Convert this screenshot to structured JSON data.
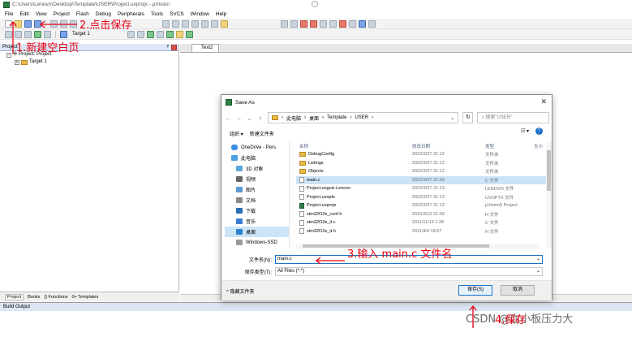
{
  "window": {
    "title": "C:\\Users\\Lenovo\\Desktop\\Template\\USER\\Project.uvprojx - µVision"
  },
  "menu": [
    "File",
    "Edit",
    "View",
    "Project",
    "Flash",
    "Debug",
    "Peripherals",
    "Tools",
    "SVCS",
    "Window",
    "Help"
  ],
  "toolbar": {
    "target": "Target 1"
  },
  "project_panel": {
    "title": "Project",
    "root": "Project: Project",
    "target": "Target 1",
    "tabs": [
      "Project",
      "Books",
      "{} Functions",
      "0+ Templates"
    ]
  },
  "editor": {
    "tab": "Text2"
  },
  "build_output": {
    "title": "Build Output"
  },
  "dialog": {
    "title": "Save As",
    "breadcrumb": [
      "此电脑",
      "桌面",
      "Template",
      "USER"
    ],
    "search_placeholder": "搜索\"USER\"",
    "organize": "组织 ▾",
    "new_folder": "新建文件夹",
    "nav": [
      {
        "label": "OneDrive - Pers",
        "icon": "cloud-icon"
      },
      {
        "label": "此电脑",
        "icon": "computer-icon"
      },
      {
        "label": "3D 对象",
        "icon": "3d-objects-icon"
      },
      {
        "label": "视频",
        "icon": "video-icon"
      },
      {
        "label": "图片",
        "icon": "pictures-icon"
      },
      {
        "label": "文档",
        "icon": "documents-icon"
      },
      {
        "label": "下载",
        "icon": "download-icon"
      },
      {
        "label": "音乐",
        "icon": "music-icon"
      },
      {
        "label": "桌面",
        "icon": "desktop-icon"
      },
      {
        "label": "Windows-SSD",
        "icon": "drive-icon"
      }
    ],
    "columns": {
      "name": "名称",
      "date": "修改日期",
      "type": "类型",
      "size": "大小"
    },
    "files": [
      {
        "name": "DebugConfig",
        "date": "2022/3/27 21:12",
        "type": "文件夹",
        "kind": "folder"
      },
      {
        "name": "Listings",
        "date": "2022/3/27 21:12",
        "type": "文件夹",
        "kind": "folder"
      },
      {
        "name": "Objects",
        "date": "2022/3/27 21:12",
        "type": "文件夹",
        "kind": "folder"
      },
      {
        "name": "main.c",
        "date": "2022/3/27 21:59",
        "type": "C 文件",
        "kind": "file"
      },
      {
        "name": "Project.uvguix.Lenovo",
        "date": "2022/3/27 21:13",
        "type": "LENOVO 文件",
        "kind": "file"
      },
      {
        "name": "Project.uvoptx",
        "date": "2022/3/27 21:13",
        "type": "UVOPTX 文件",
        "kind": "file"
      },
      {
        "name": "Project.uvprojx",
        "date": "2022/3/27 21:13",
        "type": "µVision5 Project",
        "kind": "proj"
      },
      {
        "name": "stm32f10x_conf.h",
        "date": "2015/3/12 21:09",
        "type": "H 文件",
        "kind": "file"
      },
      {
        "name": "stm32f10x_it.c",
        "date": "2011/11/13 1:28",
        "type": "C 文件",
        "kind": "file"
      },
      {
        "name": "stm32f10x_it.h",
        "date": "2011/4/4 18:57",
        "type": "H 文件",
        "kind": "file"
      }
    ],
    "filename_label": "文件名(N):",
    "filename_value": "main.c",
    "filetype_label": "保存类型(T):",
    "filetype_value": "All Files (*.*)",
    "hide_folders": "隐藏文件夹",
    "save": "保存(S)",
    "cancel": "取消"
  },
  "annotations": {
    "step1": "1.新建空白页",
    "step2": "2.点击保存",
    "step3": "3.输入 main.c 文件名",
    "step4": "4.保存"
  },
  "watermark": "CSDN @血小板压力大",
  "colors": {
    "annotation": "#e60012",
    "selection": "#cce4f7",
    "accent": "#1a73c8"
  }
}
